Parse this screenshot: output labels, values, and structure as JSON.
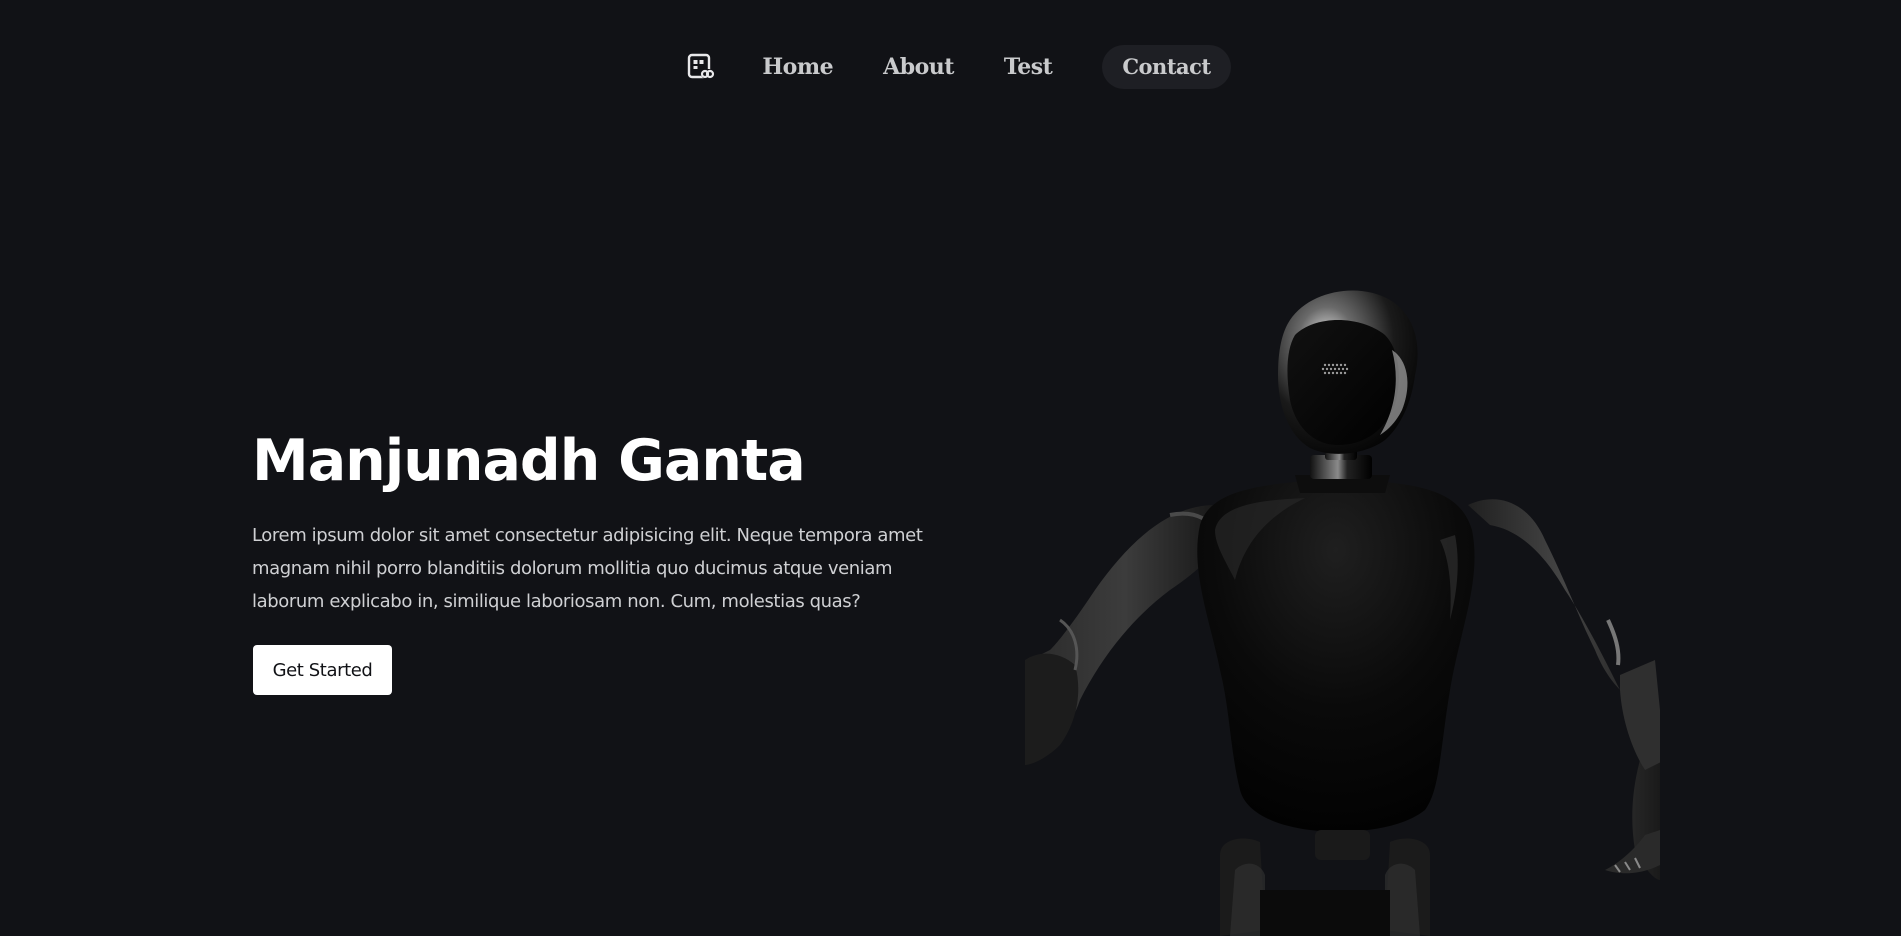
{
  "nav": {
    "logo_icon": "contact-card-link-icon",
    "items": [
      {
        "label": "Home"
      },
      {
        "label": "About"
      },
      {
        "label": "Test"
      }
    ],
    "contact_label": "Contact"
  },
  "hero": {
    "title": "Manjunadh Ganta",
    "description": "Lorem ipsum dolor sit amet consectetur adipisicing elit. Neque tempora amet magnam nihil porro blanditiis dolorum mollitia quo ducimus atque veniam laborum explicabo in, similique laboriosam non. Cum, molestias quas?",
    "cta_label": "Get Started",
    "image": "robot-illustration"
  },
  "colors": {
    "background": "#111216",
    "text_primary": "#ffffff",
    "text_secondary": "#cfd0d3",
    "nav_text": "#c9cacc",
    "contact_bg": "#1e1f24",
    "button_bg": "#ffffff"
  }
}
